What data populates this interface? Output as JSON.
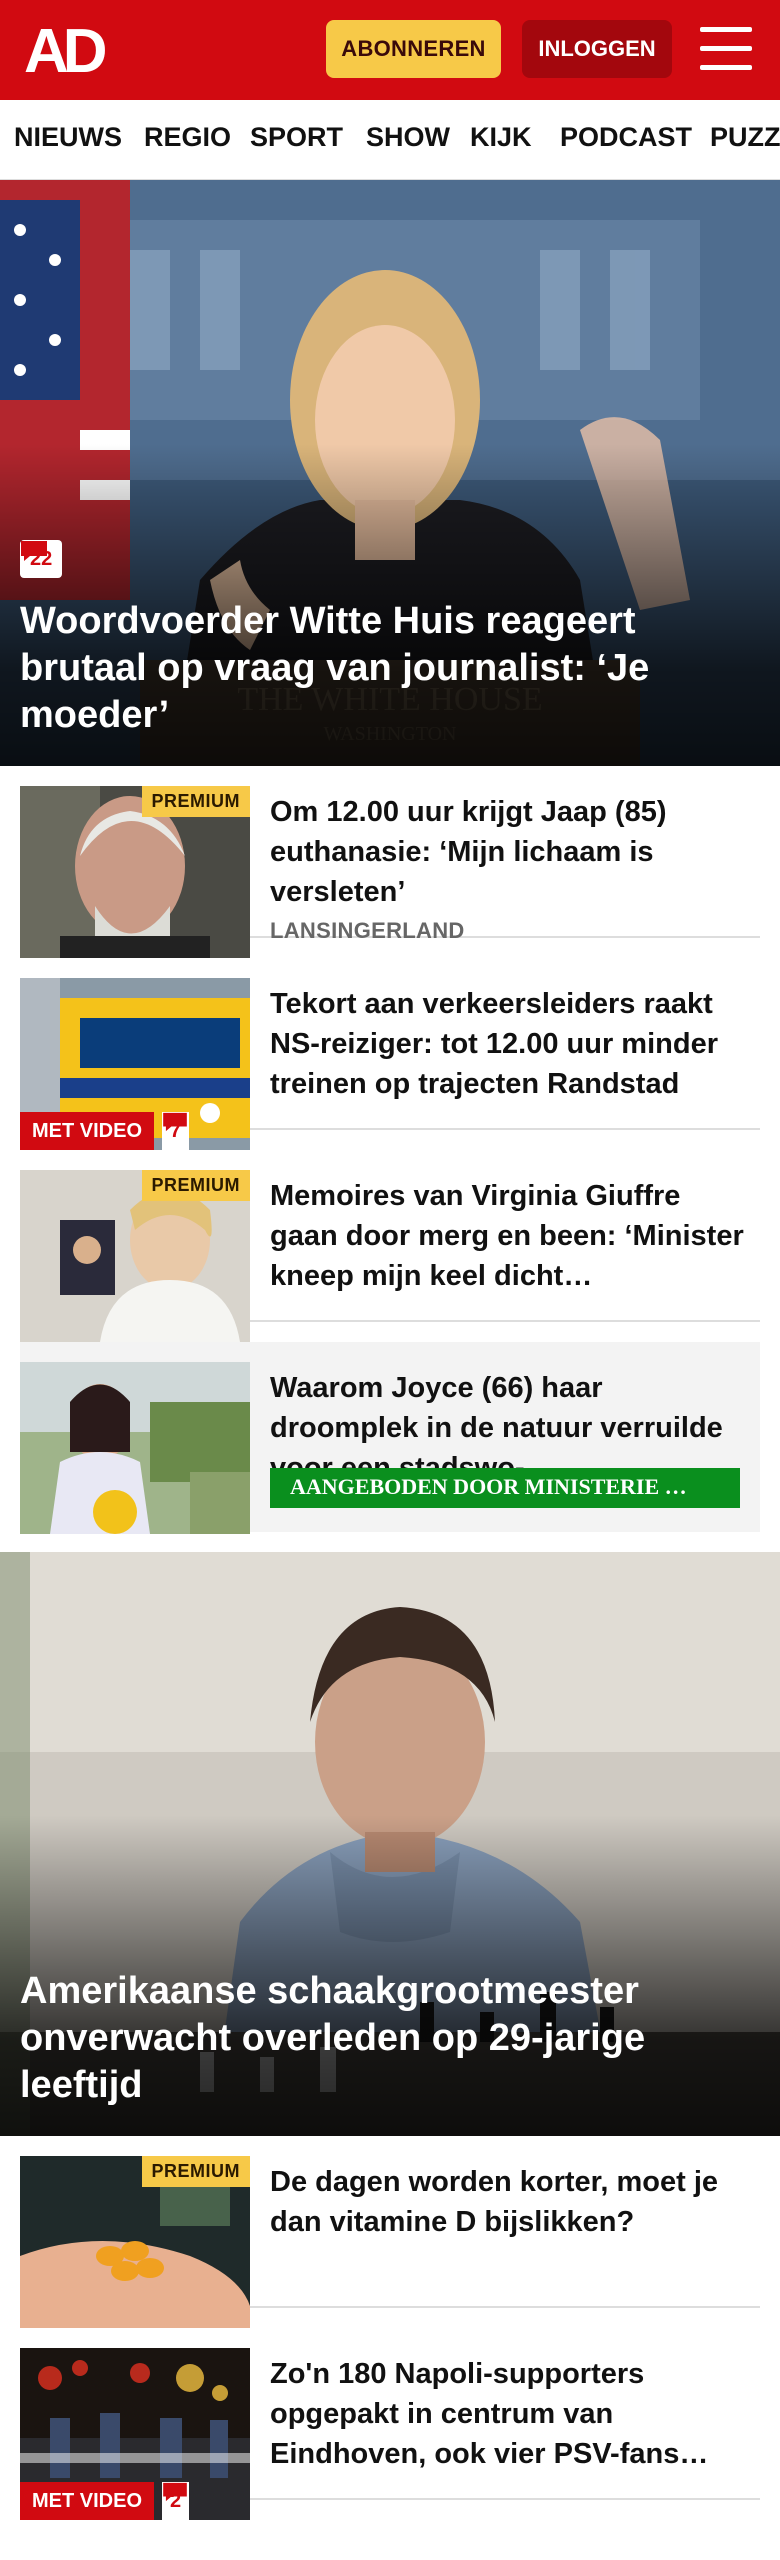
{
  "header": {
    "logo_text": "AD",
    "subscribe_label": "ABONNEREN",
    "login_label": "INLOGGEN",
    "menu_icon": "hamburger-menu-icon",
    "brand_color": "#d10a11"
  },
  "nav": {
    "items": [
      "NIEUWS",
      "REGIO",
      "SPORT",
      "SHOW",
      "KIJK",
      "PODCAST",
      "PUZZ"
    ]
  },
  "hero1": {
    "comments": "22",
    "title": "Woordvoerder Witte Huis reageert brutaal op vraag van journalist: ‘Je moeder’"
  },
  "articles": [
    {
      "premium_label": "PREMIUM",
      "title": "Om 12.00 uur krijgt Jaap (85) euthanasie: ‘Mijn lichaam is versleten’",
      "location": "LANSINGERLAND"
    },
    {
      "video_label": "MET VIDEO",
      "comments": "7",
      "title": "Tekort aan verkeersleiders raakt NS-reiziger: tot 12.00 uur minder treinen op trajecten Randstad"
    },
    {
      "premium_label": "PREMIUM",
      "title": "Memoires van Virginia Giuffre gaan door merg en been: ‘Minister kneep mijn keel dicht…"
    },
    {
      "title": "Waarom Joyce (66) haar droomplek in de natuur verruilde voor een stadswo-…",
      "sponsor_label": "AANGEBODEN DOOR MINISTERIE …"
    }
  ],
  "hero2": {
    "title": "Amerikaanse schaakgrootmeester onverwacht overleden op 29-jarige leeftijd"
  },
  "articles2": [
    {
      "premium_label": "PREMIUM",
      "title": "De dagen worden korter, moet je dan vitamine D bijslikken?"
    },
    {
      "video_label": "MET VIDEO",
      "comments": "2",
      "title": "Zo'n 180 Napoli-supporters opgepakt in centrum van Eindhoven, ook vier PSV-fans…"
    }
  ]
}
